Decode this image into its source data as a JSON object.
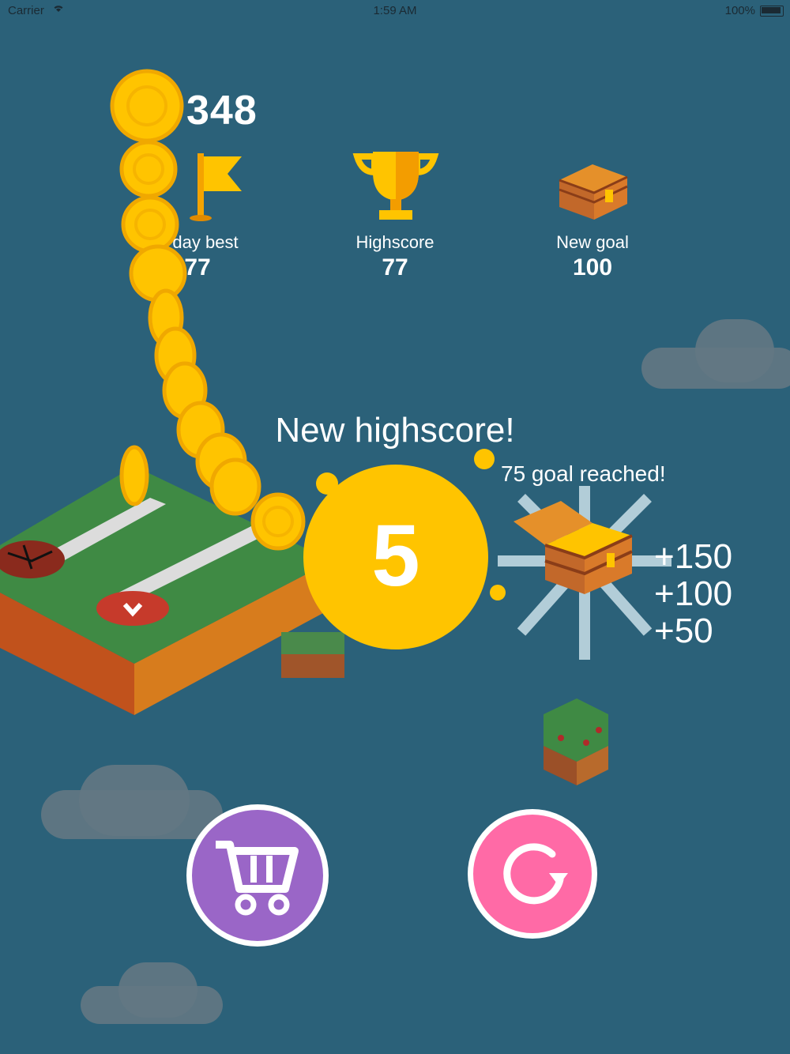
{
  "status_bar": {
    "carrier": "Carrier",
    "time": "1:59 AM",
    "battery": "100%"
  },
  "coins": {
    "count": "348",
    "icon": "coin-icon"
  },
  "stats": [
    {
      "label": "day best",
      "value": "77",
      "icon": "flag-icon"
    },
    {
      "label": "Highscore",
      "value": "77",
      "icon": "trophy-icon"
    },
    {
      "label": "New goal",
      "value": "100",
      "icon": "treasure-chest-icon"
    }
  ],
  "result": {
    "headline": "New highscore!",
    "score": "5",
    "goal_message": "75 goal reached!",
    "bonuses": [
      "+150",
      "+100",
      "+50"
    ]
  },
  "buttons": {
    "shop_icon": "cart-icon",
    "replay_icon": "replay-icon"
  },
  "colors": {
    "background": "#2b6179",
    "score_circle": "#ffc400",
    "shop_button": "#9a66c7",
    "replay_button": "#ff6aa6"
  }
}
